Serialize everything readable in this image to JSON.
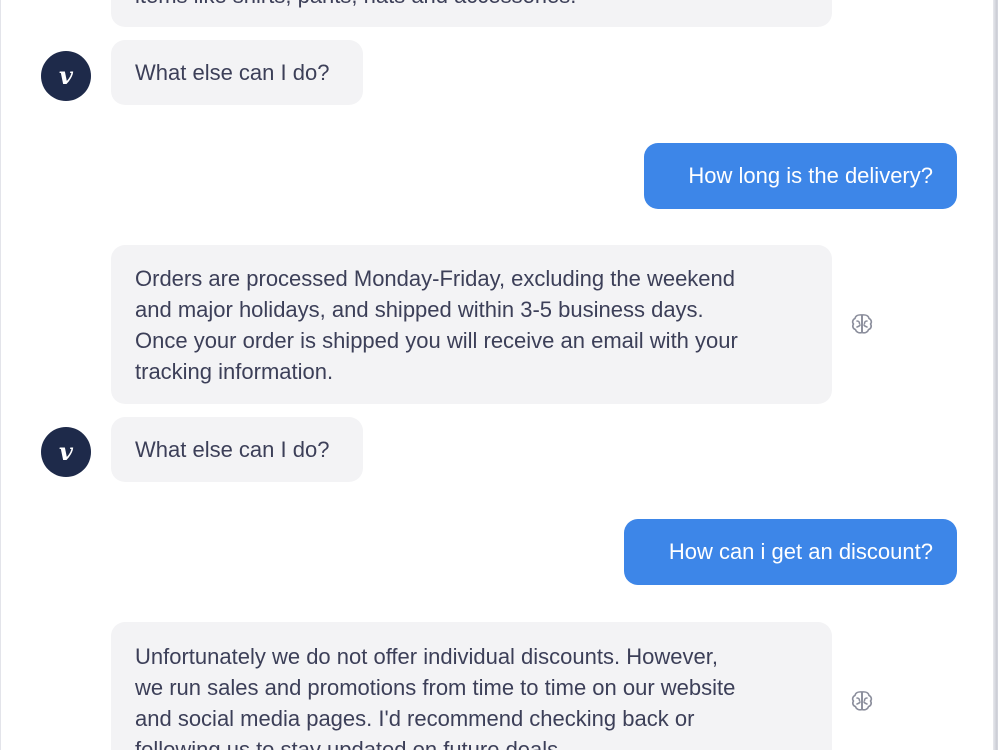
{
  "messages": {
    "m0_partial": {
      "lines": [
        "items like shirts, pants, hats and accessories."
      ]
    },
    "m1": {
      "text": "What else can I do?"
    },
    "m2": {
      "text": "How long is the delivery?"
    },
    "m3": {
      "lines": [
        "Orders are processed Monday-Friday, excluding the weekend",
        "and major holidays, and shipped within 3-5 business days.",
        "Once your order is shipped you will receive an email with your",
        "tracking information."
      ]
    },
    "m4": {
      "text": "What else can I do?"
    },
    "m5": {
      "text": "How can i get an discount?"
    },
    "m6": {
      "lines": [
        "Unfortunately we do not offer individual discounts. However,",
        "we run sales and promotions from time to time on our website",
        "and social media pages. I'd recommend checking back or",
        "following us to stay updated on future deals."
      ]
    }
  },
  "avatar": {
    "glyph": "v"
  },
  "icons": {
    "avatar": "bot-logo-icon",
    "feedback": "brain-icon"
  },
  "colors": {
    "user_bubble": "#3d86e8",
    "bot_bubble": "#f3f3f5",
    "avatar_bg": "#1e2a4a",
    "text": "#3c3f58"
  }
}
